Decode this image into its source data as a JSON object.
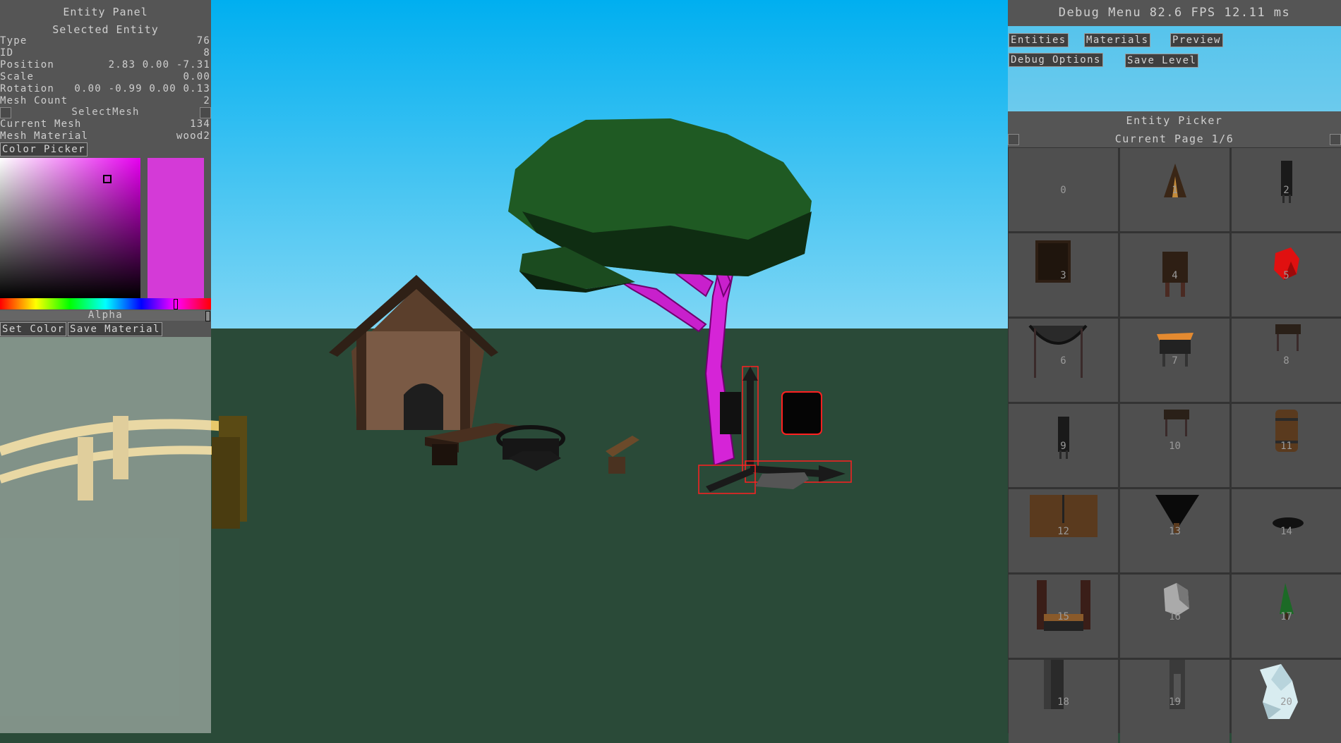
{
  "entity_panel": {
    "title": "Entity Panel",
    "subtitle": "Selected Entity",
    "rows": [
      {
        "label": "Type",
        "value": "76"
      },
      {
        "label": "ID",
        "value": "8"
      },
      {
        "label": "Position",
        "value": "2.83 0.00 -7.31"
      },
      {
        "label": "Scale",
        "value": "0.00"
      },
      {
        "label": "Rotation",
        "value": "0.00 -0.99 0.00 0.13"
      },
      {
        "label": "Mesh Count",
        "value": "2"
      }
    ],
    "select_mesh_label": "SelectMesh",
    "mesh_rows": [
      {
        "label": "Current Mesh",
        "value": "134"
      },
      {
        "label": "Mesh Material",
        "value": "wood2"
      }
    ],
    "color_picker_label": "Color Picker",
    "selected_color": "#d43ad7",
    "alpha_label": "Alpha",
    "set_color_label": "Set Color",
    "save_material_label": "Save Material"
  },
  "debug_menu": {
    "title": "Debug Menu 82.6 FPS 12.11 ms",
    "buttons": [
      "Entities",
      "Materials",
      "Preview",
      "Debug Options",
      "Save Level"
    ]
  },
  "entity_picker": {
    "title": "Entity Picker",
    "page": "Current Page 1/6",
    "items": [
      {
        "num": "0",
        "icon": "empty-icon"
      },
      {
        "num": "1",
        "icon": "tent-icon"
      },
      {
        "num": "2",
        "icon": "chair-icon"
      },
      {
        "num": "3",
        "icon": "wardrobe-icon"
      },
      {
        "num": "4",
        "icon": "cabinet-icon"
      },
      {
        "num": "5",
        "icon": "red-crystal-icon"
      },
      {
        "num": "6",
        "icon": "hammock-icon"
      },
      {
        "num": "7",
        "icon": "table-icon"
      },
      {
        "num": "8",
        "icon": "stool-icon"
      },
      {
        "num": "9",
        "icon": "chair-icon"
      },
      {
        "num": "10",
        "icon": "stool-icon"
      },
      {
        "num": "11",
        "icon": "barrel-icon"
      },
      {
        "num": "12",
        "icon": "crate-icon"
      },
      {
        "num": "13",
        "icon": "cone-icon"
      },
      {
        "num": "14",
        "icon": "bowl-icon"
      },
      {
        "num": "15",
        "icon": "bench-icon"
      },
      {
        "num": "16",
        "icon": "rock-icon"
      },
      {
        "num": "17",
        "icon": "pine-tree-icon"
      },
      {
        "num": "18",
        "icon": "pillar-icon"
      },
      {
        "num": "19",
        "icon": "post-icon"
      },
      {
        "num": "20",
        "icon": "ice-rock-icon"
      }
    ]
  },
  "colors": {
    "sky_top": "#00aff0",
    "sky_bottom": "#7fd6f4",
    "ground": "#2a4a38",
    "wireframe": "#e020e0",
    "gizmo": "#ff2020"
  }
}
